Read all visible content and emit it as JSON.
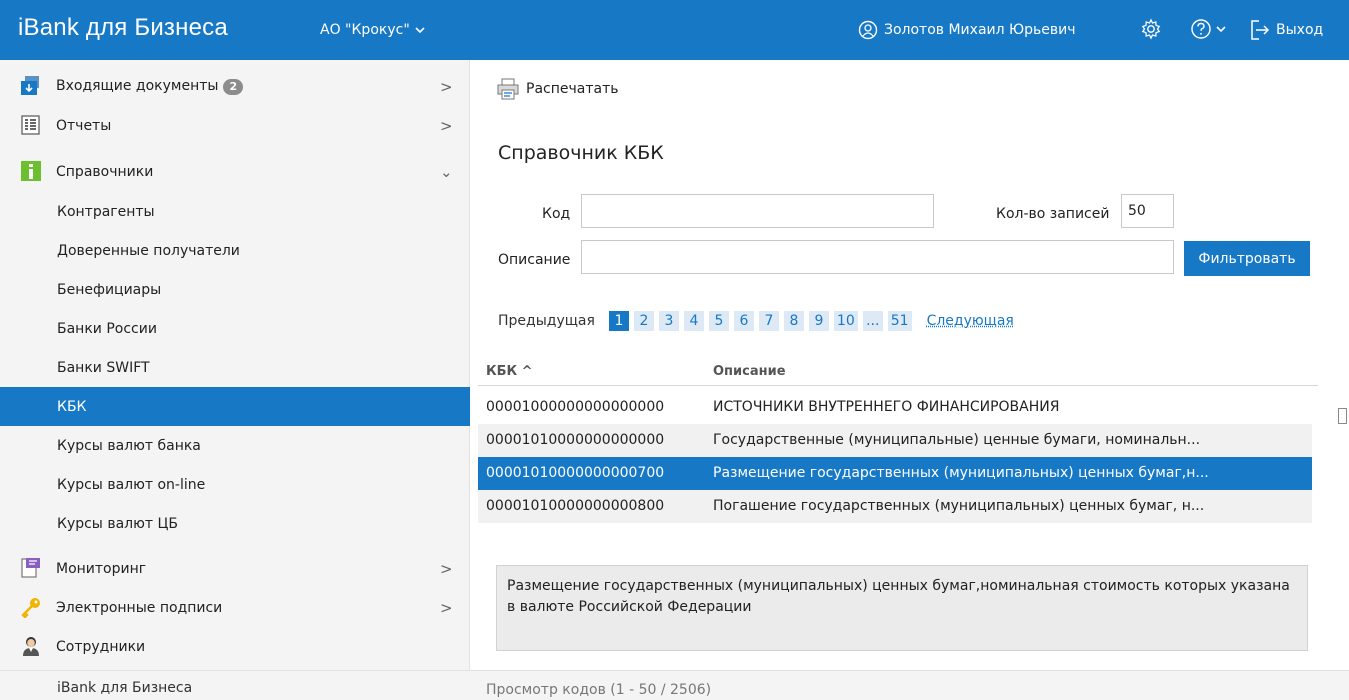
{
  "topbar": {
    "brand": "iBank для Бизнеса",
    "org": "АО \"Крокус\"",
    "user": "Золотов Михаил Юрьевич",
    "logout": "Выход"
  },
  "sidebar": {
    "items": [
      {
        "label": "Входящие документы",
        "badge": "2"
      },
      {
        "label": "Отчеты"
      },
      {
        "label": "Справочники"
      },
      {
        "label": "Контрагенты"
      },
      {
        "label": "Доверенные получатели"
      },
      {
        "label": "Бенефициары"
      },
      {
        "label": "Банки России"
      },
      {
        "label": "Банки SWIFT"
      },
      {
        "label": "КБК"
      },
      {
        "label": "Курсы валют банка"
      },
      {
        "label": "Курсы валют on-line"
      },
      {
        "label": "Курсы валют ЦБ"
      },
      {
        "label": "Мониторинг"
      },
      {
        "label": "Электронные подписи"
      },
      {
        "label": "Сотрудники"
      }
    ]
  },
  "main": {
    "print_label": "Распечатать",
    "title": "Справочник КБК",
    "filter": {
      "code_label": "Код",
      "code_value": "",
      "count_label": "Кол-во записей",
      "count_value": "50",
      "desc_label": "Описание",
      "desc_value": "",
      "button": "Фильтровать"
    },
    "pager": {
      "prev": "Предыдущая",
      "pages": [
        "1",
        "2",
        "3",
        "4",
        "5",
        "6",
        "7",
        "8",
        "9",
        "10",
        "...",
        "51"
      ],
      "current": "1",
      "next": "Следующая"
    },
    "table": {
      "col1": "КБК ^",
      "col2": "Описание",
      "rows": [
        {
          "kbk": "00001000000000000000",
          "desc": "ИСТОЧНИКИ ВНУТРЕННЕГО ФИНАНСИРОВАНИЯ"
        },
        {
          "kbk": "00001010000000000000",
          "desc": "Государственные (муниципальные) ценные бумаги, номинальн..."
        },
        {
          "kbk": "00001010000000000700",
          "desc": "Размещение государственных (муниципальных) ценных бумаг,н..."
        },
        {
          "kbk": "00001010000000000800",
          "desc": "Погашение государственных (муниципальных) ценных бумаг, н..."
        }
      ]
    },
    "detail": "Размещение государственных (муниципальных) ценных бумаг,номинальная стоимость которых указана в валюте Российской Федерации"
  },
  "footer": {
    "left": "iBank для Бизнеса",
    "right": "Просмотр кодов (1 - 50 / 2506)"
  },
  "colors": {
    "accent": "#1779c6",
    "sidebar_bg": "#f4f4f4",
    "row_alt": "#f1f1f1"
  }
}
